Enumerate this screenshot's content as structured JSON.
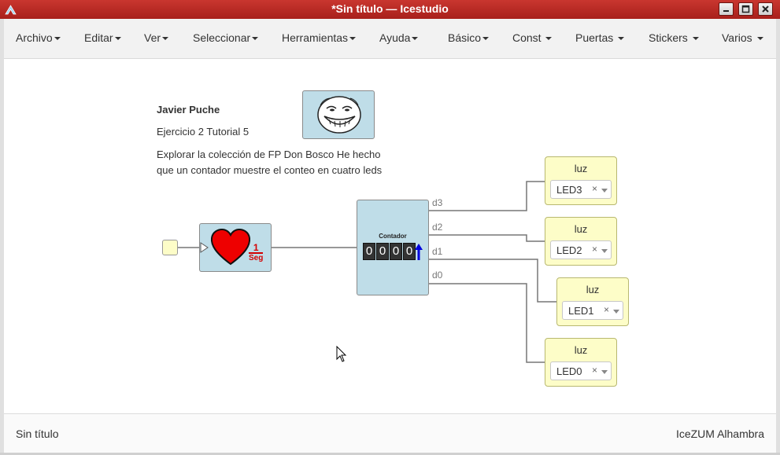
{
  "window": {
    "title": "*Sin título — Icestudio",
    "app_icon": "icestudio-icon",
    "controls": [
      "minimize-icon",
      "maximize-icon",
      "close-icon"
    ]
  },
  "menubar": {
    "items": [
      {
        "label": "Archivo"
      },
      {
        "label": "Editar"
      },
      {
        "label": "Ver"
      },
      {
        "label": "Seleccionar"
      },
      {
        "label": "Herramientas"
      },
      {
        "label": "Ayuda"
      },
      {
        "label": "Básico"
      },
      {
        "label": "Const"
      },
      {
        "label": "Puertas"
      },
      {
        "label": "Stickers"
      },
      {
        "label": "Varios"
      }
    ]
  },
  "canvas": {
    "info": {
      "author": "Javier Puche",
      "subtitle": "Ejercicio 2 Tutorial 5",
      "description": "Explorar la colección de FP Don Bosco He hecho que un contador muestre el conteo en cuatro leds"
    },
    "image_block": {
      "icon": "troll-face-icon"
    },
    "heartbeat": {
      "icon": "heart-icon",
      "fraction_num": "1",
      "fraction_den": "Seg"
    },
    "counter": {
      "label": "Contador",
      "digits": [
        "0",
        "0",
        "0",
        "0"
      ],
      "arrow_icon": "arrow-up-icon",
      "ports": [
        "d3",
        "d2",
        "d1",
        "d0"
      ]
    },
    "outputs": [
      {
        "label": "luz",
        "value": "LED3",
        "clear": "×"
      },
      {
        "label": "luz",
        "value": "LED2",
        "clear": "×"
      },
      {
        "label": "luz",
        "value": "LED1",
        "clear": "×"
      },
      {
        "label": "luz",
        "value": "LED0",
        "clear": "×"
      }
    ]
  },
  "statusbar": {
    "left": "Sin título",
    "right": "IceZUM Alhambra"
  },
  "colors": {
    "titlebar": "#b8271f",
    "block_blue": "#bfdde8",
    "block_yellow": "#fdfdc8",
    "heart": "#e00000",
    "arrow": "#0000dd"
  }
}
